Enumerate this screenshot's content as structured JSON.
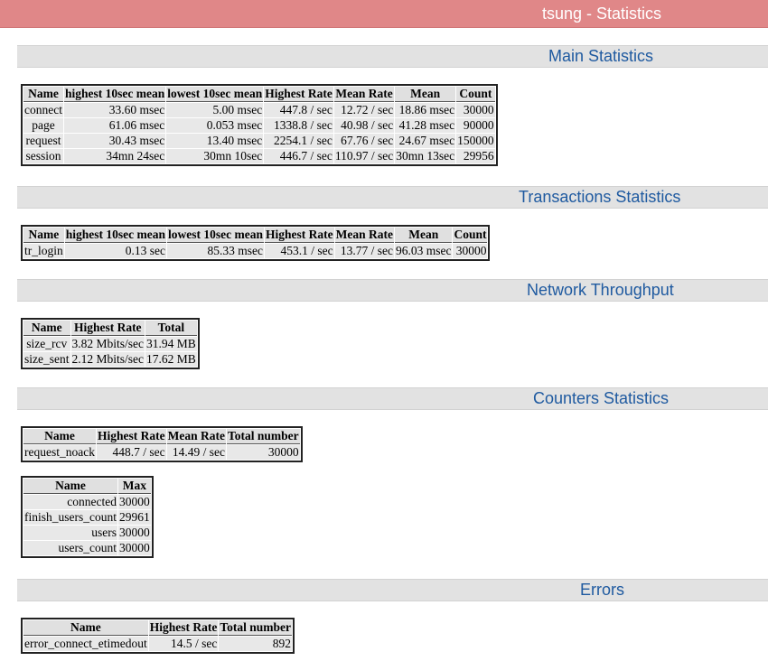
{
  "header": {
    "title": "tsung - Statistics"
  },
  "sections": {
    "main": "Main Statistics",
    "transactions": "Transactions Statistics",
    "network": "Network Throughput",
    "counters": "Counters Statistics",
    "errors": "Errors"
  },
  "main_table": {
    "headers": [
      "Name",
      "highest 10sec mean",
      "lowest 10sec mean",
      "Highest Rate",
      "Mean Rate",
      "Mean",
      "Count"
    ],
    "rows": [
      [
        "connect",
        "33.60 msec",
        "5.00 msec",
        "447.8 / sec",
        "12.72 / sec",
        "18.86 msec",
        "30000"
      ],
      [
        "page",
        "61.06 msec",
        "0.053 msec",
        "1338.8 / sec",
        "40.98 / sec",
        "41.28 msec",
        "90000"
      ],
      [
        "request",
        "30.43 msec",
        "13.40 msec",
        "2254.1 / sec",
        "67.76 / sec",
        "24.67 msec",
        "150000"
      ],
      [
        "session",
        "34mn 24sec",
        "30mn 10sec",
        "446.7 / sec",
        "110.97 / sec",
        "30mn 13sec",
        "29956"
      ]
    ]
  },
  "transactions_table": {
    "headers": [
      "Name",
      "highest 10sec mean",
      "lowest 10sec mean",
      "Highest Rate",
      "Mean Rate",
      "Mean",
      "Count"
    ],
    "rows": [
      [
        "tr_login",
        "0.13 sec",
        "85.33 msec",
        "453.1 / sec",
        "13.77 / sec",
        "96.03 msec",
        "30000"
      ]
    ]
  },
  "network_table": {
    "headers": [
      "Name",
      "Highest Rate",
      "Total"
    ],
    "rows": [
      [
        "size_rcv",
        "3.82 Mbits/sec",
        "31.94 MB"
      ],
      [
        "size_sent",
        "2.12 Mbits/sec",
        "17.62 MB"
      ]
    ]
  },
  "counters_rate_table": {
    "headers": [
      "Name",
      "Highest Rate",
      "Mean Rate",
      "Total number"
    ],
    "rows": [
      [
        "request_noack",
        "448.7 / sec",
        "14.49 / sec",
        "30000"
      ]
    ]
  },
  "counters_max_table": {
    "headers": [
      "Name",
      "Max"
    ],
    "rows": [
      [
        "connected",
        "30000"
      ],
      [
        "finish_users_count",
        "29961"
      ],
      [
        "users",
        "30000"
      ],
      [
        "users_count",
        "30000"
      ]
    ]
  },
  "errors_table": {
    "headers": [
      "Name",
      "Highest Rate",
      "Total number"
    ],
    "rows": [
      [
        "error_connect_etimedout",
        "14.5 / sec",
        "892"
      ]
    ]
  }
}
